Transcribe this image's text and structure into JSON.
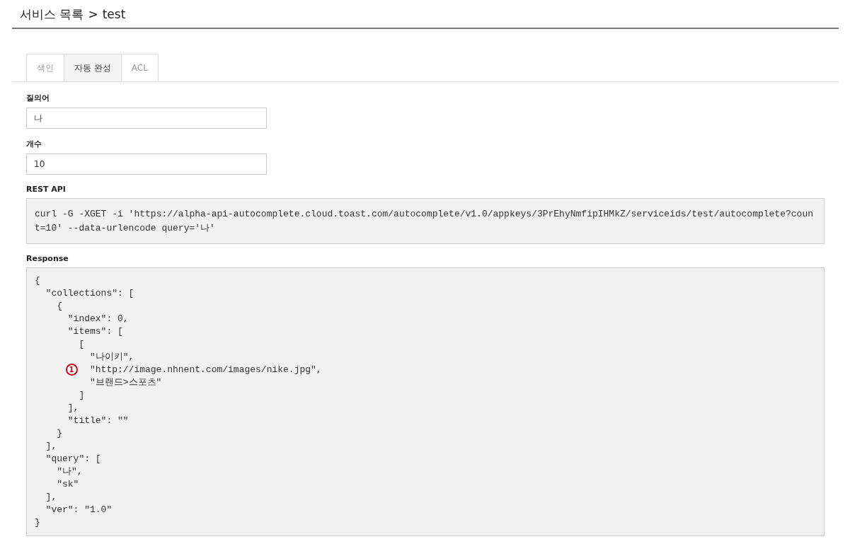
{
  "breadcrumb": {
    "parent": "서비스 목록",
    "separator": ">",
    "current": "test"
  },
  "tabs": [
    {
      "label": "색인",
      "selected": false
    },
    {
      "label": "자동 완성",
      "selected": true
    },
    {
      "label": "ACL",
      "selected": false
    }
  ],
  "fields": [
    {
      "label": "질의어",
      "value": "나"
    },
    {
      "label": "개수",
      "value": "10"
    }
  ],
  "rest_api": {
    "label": "REST API",
    "command": "curl -G -XGET -i 'https://alpha-api-autocomplete.cloud.toast.com/autocomplete/v1.0/appkeys/3PrEhyNmfipIHMkZ/serviceids/test/autocomplete?count=10' --data-urlencode query='나'"
  },
  "response": {
    "label": "Response",
    "lines": [
      {
        "text": "{"
      },
      {
        "text": "  \"collections\": ["
      },
      {
        "text": "    {"
      },
      {
        "text": "      \"index\": 0,"
      },
      {
        "text": "      \"items\": ["
      },
      {
        "text": "        ["
      },
      {
        "text": "          \"나이키\","
      },
      {
        "text": "          \"http://image.nhnent.com/images/nike.jpg\",",
        "marker": "1"
      },
      {
        "text": "          \"브랜드>스포츠\""
      },
      {
        "text": "        ]"
      },
      {
        "text": "      ],"
      },
      {
        "text": "      \"title\": \"\""
      },
      {
        "text": "    }"
      },
      {
        "text": "  ],"
      },
      {
        "text": "  \"query\": ["
      },
      {
        "text": "    \"나\","
      },
      {
        "text": "    \"sk\""
      },
      {
        "text": "  ],"
      },
      {
        "text": "  \"ver\": \"1.0\""
      },
      {
        "text": "}"
      }
    ]
  }
}
